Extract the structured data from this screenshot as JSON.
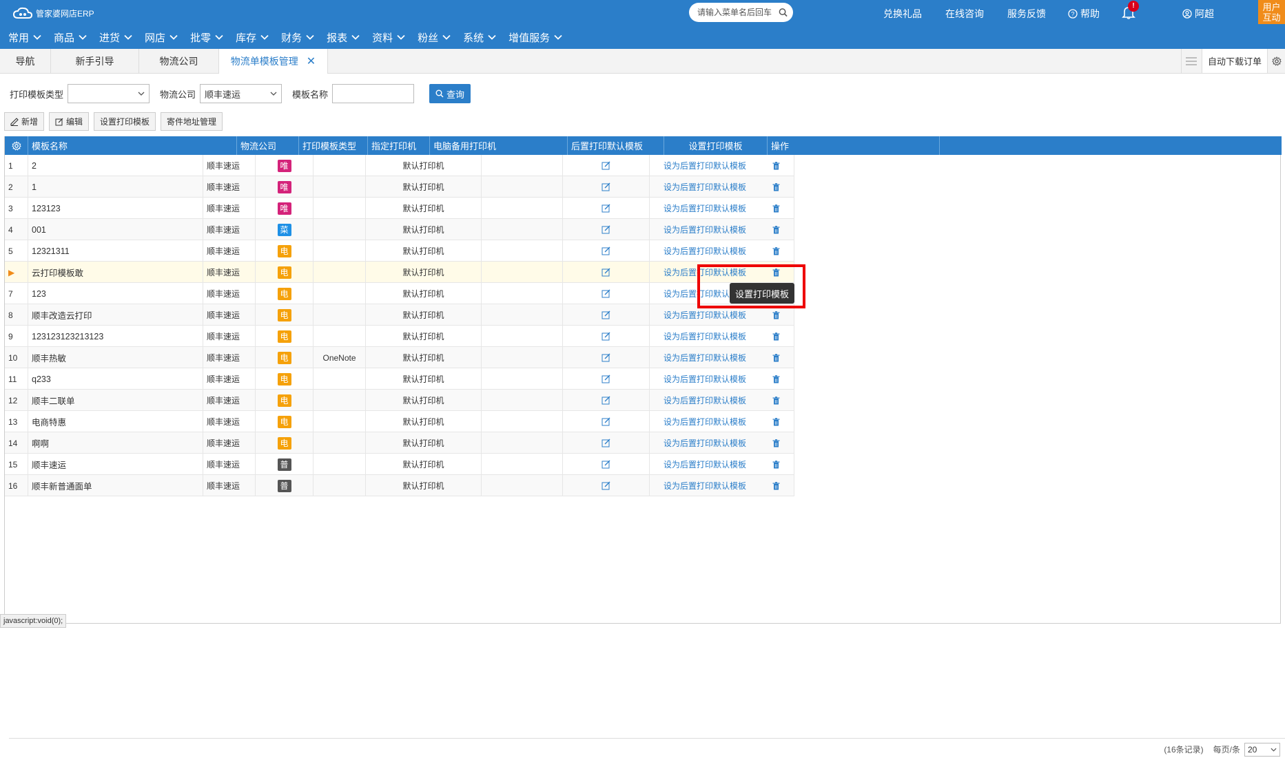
{
  "header": {
    "logo_text": "管家婆网店ERP",
    "search_placeholder": "请输入菜单名后回车",
    "links": [
      "兑换礼品",
      "在线咨询",
      "服务反馈"
    ],
    "help_label": "帮助",
    "notification_badge": "!",
    "username": "阿超",
    "user_box_line1": "用户",
    "user_box_line2": "互动"
  },
  "menu": [
    "常用",
    "商品",
    "进货",
    "网店",
    "批零",
    "库存",
    "财务",
    "报表",
    "资料",
    "粉丝",
    "系统",
    "增值服务"
  ],
  "tabs": [
    {
      "label": "导航"
    },
    {
      "label": "新手引导"
    },
    {
      "label": "物流公司"
    },
    {
      "label": "物流单模板管理",
      "active": true
    }
  ],
  "tab_right": {
    "auto_download_label": "自动下载订单"
  },
  "filters": {
    "template_type_label": "打印模板类型",
    "template_type_value": "",
    "company_label": "物流公司",
    "company_value": "顺丰速运",
    "template_name_label": "模板名称",
    "template_name_value": "",
    "query_label": "查询"
  },
  "actions": {
    "add": "新增",
    "edit": "编辑",
    "set_template": "设置打印模板",
    "sender_address": "寄件地址管理"
  },
  "table": {
    "columns": [
      "模板名称",
      "物流公司",
      "打印模板类型",
      "指定打印机",
      "电脑备用打印机",
      "后置打印默认模板",
      "设置打印模板",
      "操作"
    ],
    "rows": [
      {
        "idx": "1",
        "name": "2",
        "company": "顺丰速运",
        "type": "唯",
        "type_color": "#d4237a",
        "printer": "",
        "backup": "默认打印机",
        "op": "设为后置打印默认模板"
      },
      {
        "idx": "2",
        "name": "1",
        "company": "顺丰速运",
        "type": "唯",
        "type_color": "#d4237a",
        "printer": "",
        "backup": "默认打印机",
        "op": "设为后置打印默认模板"
      },
      {
        "idx": "3",
        "name": "123123",
        "company": "顺丰速运",
        "type": "唯",
        "type_color": "#d4237a",
        "printer": "",
        "backup": "默认打印机",
        "op": "设为后置打印默认模板"
      },
      {
        "idx": "4",
        "name": "001",
        "company": "顺丰速运",
        "type": "菜",
        "type_color": "#1e90e6",
        "printer": "",
        "backup": "默认打印机",
        "op": "设为后置打印默认模板"
      },
      {
        "idx": "5",
        "name": "12321311",
        "company": "顺丰速运",
        "type": "电",
        "type_color": "#f5a10a",
        "printer": "",
        "backup": "默认打印机",
        "op": "设为后置打印默认模板"
      },
      {
        "idx": "▶",
        "name": "云打印模板敢",
        "company": "顺丰速运",
        "type": "电",
        "type_color": "#f5a10a",
        "printer": "",
        "backup": "默认打印机",
        "op": "设为后置打印默认模板",
        "selected": true
      },
      {
        "idx": "7",
        "name": "123",
        "company": "顺丰速运",
        "type": "电",
        "type_color": "#f5a10a",
        "printer": "",
        "backup": "默认打印机",
        "op": "设为后置打印默认模板"
      },
      {
        "idx": "8",
        "name": "顺丰改造云打印",
        "company": "顺丰速运",
        "type": "电",
        "type_color": "#f5a10a",
        "printer": "",
        "backup": "默认打印机",
        "op": "设为后置打印默认模板"
      },
      {
        "idx": "9",
        "name": "123123123213123",
        "company": "顺丰速运",
        "type": "电",
        "type_color": "#f5a10a",
        "printer": "",
        "backup": "默认打印机",
        "op": "设为后置打印默认模板"
      },
      {
        "idx": "10",
        "name": "顺丰热敏",
        "company": "顺丰速运",
        "type": "电",
        "type_color": "#f5a10a",
        "printer": "OneNote",
        "backup": "默认打印机",
        "op": "设为后置打印默认模板"
      },
      {
        "idx": "11",
        "name": "q233",
        "company": "顺丰速运",
        "type": "电",
        "type_color": "#f5a10a",
        "printer": "",
        "backup": "默认打印机",
        "op": "设为后置打印默认模板"
      },
      {
        "idx": "12",
        "name": "顺丰二联单",
        "company": "顺丰速运",
        "type": "电",
        "type_color": "#f5a10a",
        "printer": "",
        "backup": "默认打印机",
        "op": "设为后置打印默认模板"
      },
      {
        "idx": "13",
        "name": "电商特惠",
        "company": "顺丰速运",
        "type": "电",
        "type_color": "#f5a10a",
        "printer": "",
        "backup": "默认打印机",
        "op": "设为后置打印默认模板"
      },
      {
        "idx": "14",
        "name": "啊啊",
        "company": "顺丰速运",
        "type": "电",
        "type_color": "#f5a10a",
        "printer": "",
        "backup": "默认打印机",
        "op": "设为后置打印默认模板"
      },
      {
        "idx": "15",
        "name": "顺丰速运",
        "company": "顺丰速运",
        "type": "普",
        "type_color": "#555555",
        "printer": "",
        "backup": "默认打印机",
        "op": "设为后置打印默认模板"
      },
      {
        "idx": "16",
        "name": "顺丰新普通面单",
        "company": "顺丰速运",
        "type": "普",
        "type_color": "#555555",
        "printer": "",
        "backup": "默认打印机",
        "op": "设为后置打印默认模板"
      }
    ]
  },
  "tooltip": "设置打印模板",
  "footer": {
    "record_count": "(16条记录)",
    "per_page_label": "每页/条",
    "per_page_value": "20"
  },
  "statusbar": "javascript:void(0);"
}
